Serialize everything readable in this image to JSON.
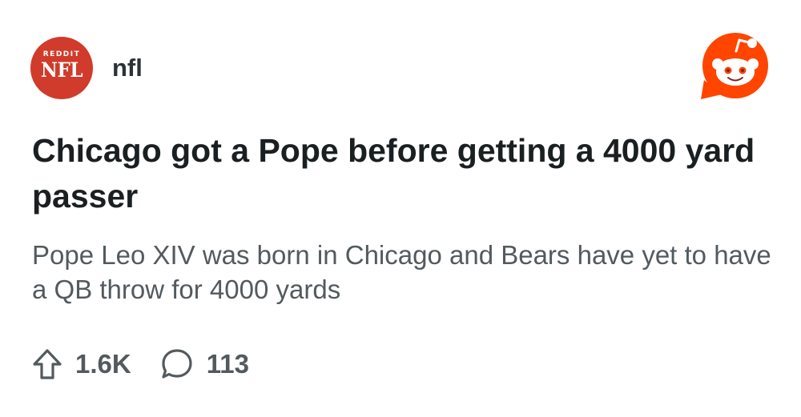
{
  "subreddit": {
    "logo_top_text": "REDDIT",
    "logo_main_text": "NFL",
    "name": "nfl",
    "logo_color": "#d13b2b"
  },
  "brand": {
    "icon": "reddit-snoo-icon",
    "color": "#ff4500"
  },
  "post": {
    "title": "Chicago got a Pope before getting a 4000 yard passer",
    "body": "Pope Leo XIV was born in Chicago and Bears have yet to have a QB throw for 4000 yards"
  },
  "stats": {
    "upvotes": "1.6K",
    "upvote_icon": "upvote-arrow-icon",
    "comments": "113",
    "comment_icon": "comment-bubble-icon"
  }
}
